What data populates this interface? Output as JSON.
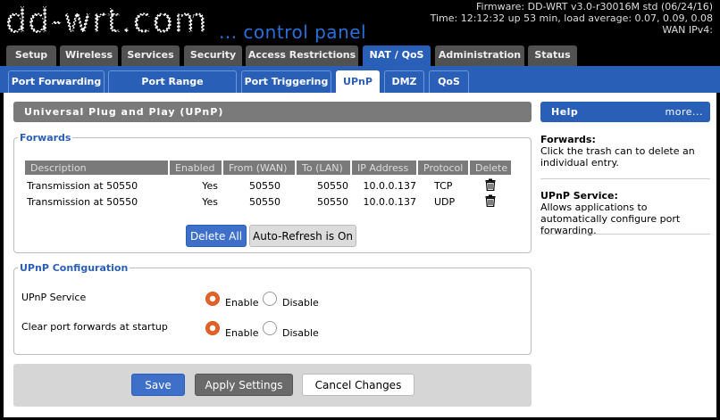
{
  "header": {
    "logo_text": "dd-wrt.com",
    "tagline": "... control panel",
    "firmware": "Firmware: DD-WRT v3.0-r30016M std (06/24/16)",
    "time": "Time: 12:12:32 up 53 min, load average: 0.07, 0.09, 0.08",
    "wan": "WAN IPv4:"
  },
  "main_tabs": [
    "Setup",
    "Wireless",
    "Services",
    "Security",
    "Access Restrictions",
    "NAT / QoS",
    "Administration",
    "Status"
  ],
  "sub_tabs": [
    "Port Forwarding",
    "Port Range Forwarding",
    "Port Triggering",
    "UPnP",
    "DMZ",
    "QoS"
  ],
  "page": {
    "title": "Universal Plug and Play (UPnP)"
  },
  "forwards": {
    "legend": "Forwards",
    "columns": [
      "Description",
      "Enabled",
      "From (WAN)",
      "To (LAN)",
      "IP Address",
      "Protocol",
      "Delete"
    ],
    "rows": [
      {
        "description": "Transmission at 50550",
        "enabled": "Yes",
        "from": "50550",
        "to": "50550",
        "ip": "10.0.0.137",
        "protocol": "TCP"
      },
      {
        "description": "Transmission at 50550",
        "enabled": "Yes",
        "from": "50550",
        "to": "50550",
        "ip": "10.0.0.137",
        "protocol": "UDP"
      }
    ],
    "delete_all_label": "Delete All",
    "auto_refresh_label": "Auto-Refresh is On"
  },
  "config": {
    "legend": "UPnP Configuration",
    "upnp_service_label": "UPnP Service",
    "clear_label": "Clear port forwards at startup",
    "enable_label": "Enable",
    "disable_label": "Disable",
    "upnp_service_value": "Enable",
    "clear_value": "Enable"
  },
  "actions": {
    "save_label": "Save",
    "apply_label": "Apply Settings",
    "cancel_label": "Cancel Changes"
  },
  "help": {
    "title": "Help",
    "more_label": "more...",
    "forwards_title": "Forwards:",
    "forwards_text": "Click the trash can to delete an individual entry.",
    "upnp_title": "UPnP Service:",
    "upnp_text": "Allows applications to automatically configure port forwarding."
  },
  "colors": {
    "accent": "#2a5fb8",
    "tab_inactive": "#515151",
    "radio_on": "#e25a1c"
  }
}
